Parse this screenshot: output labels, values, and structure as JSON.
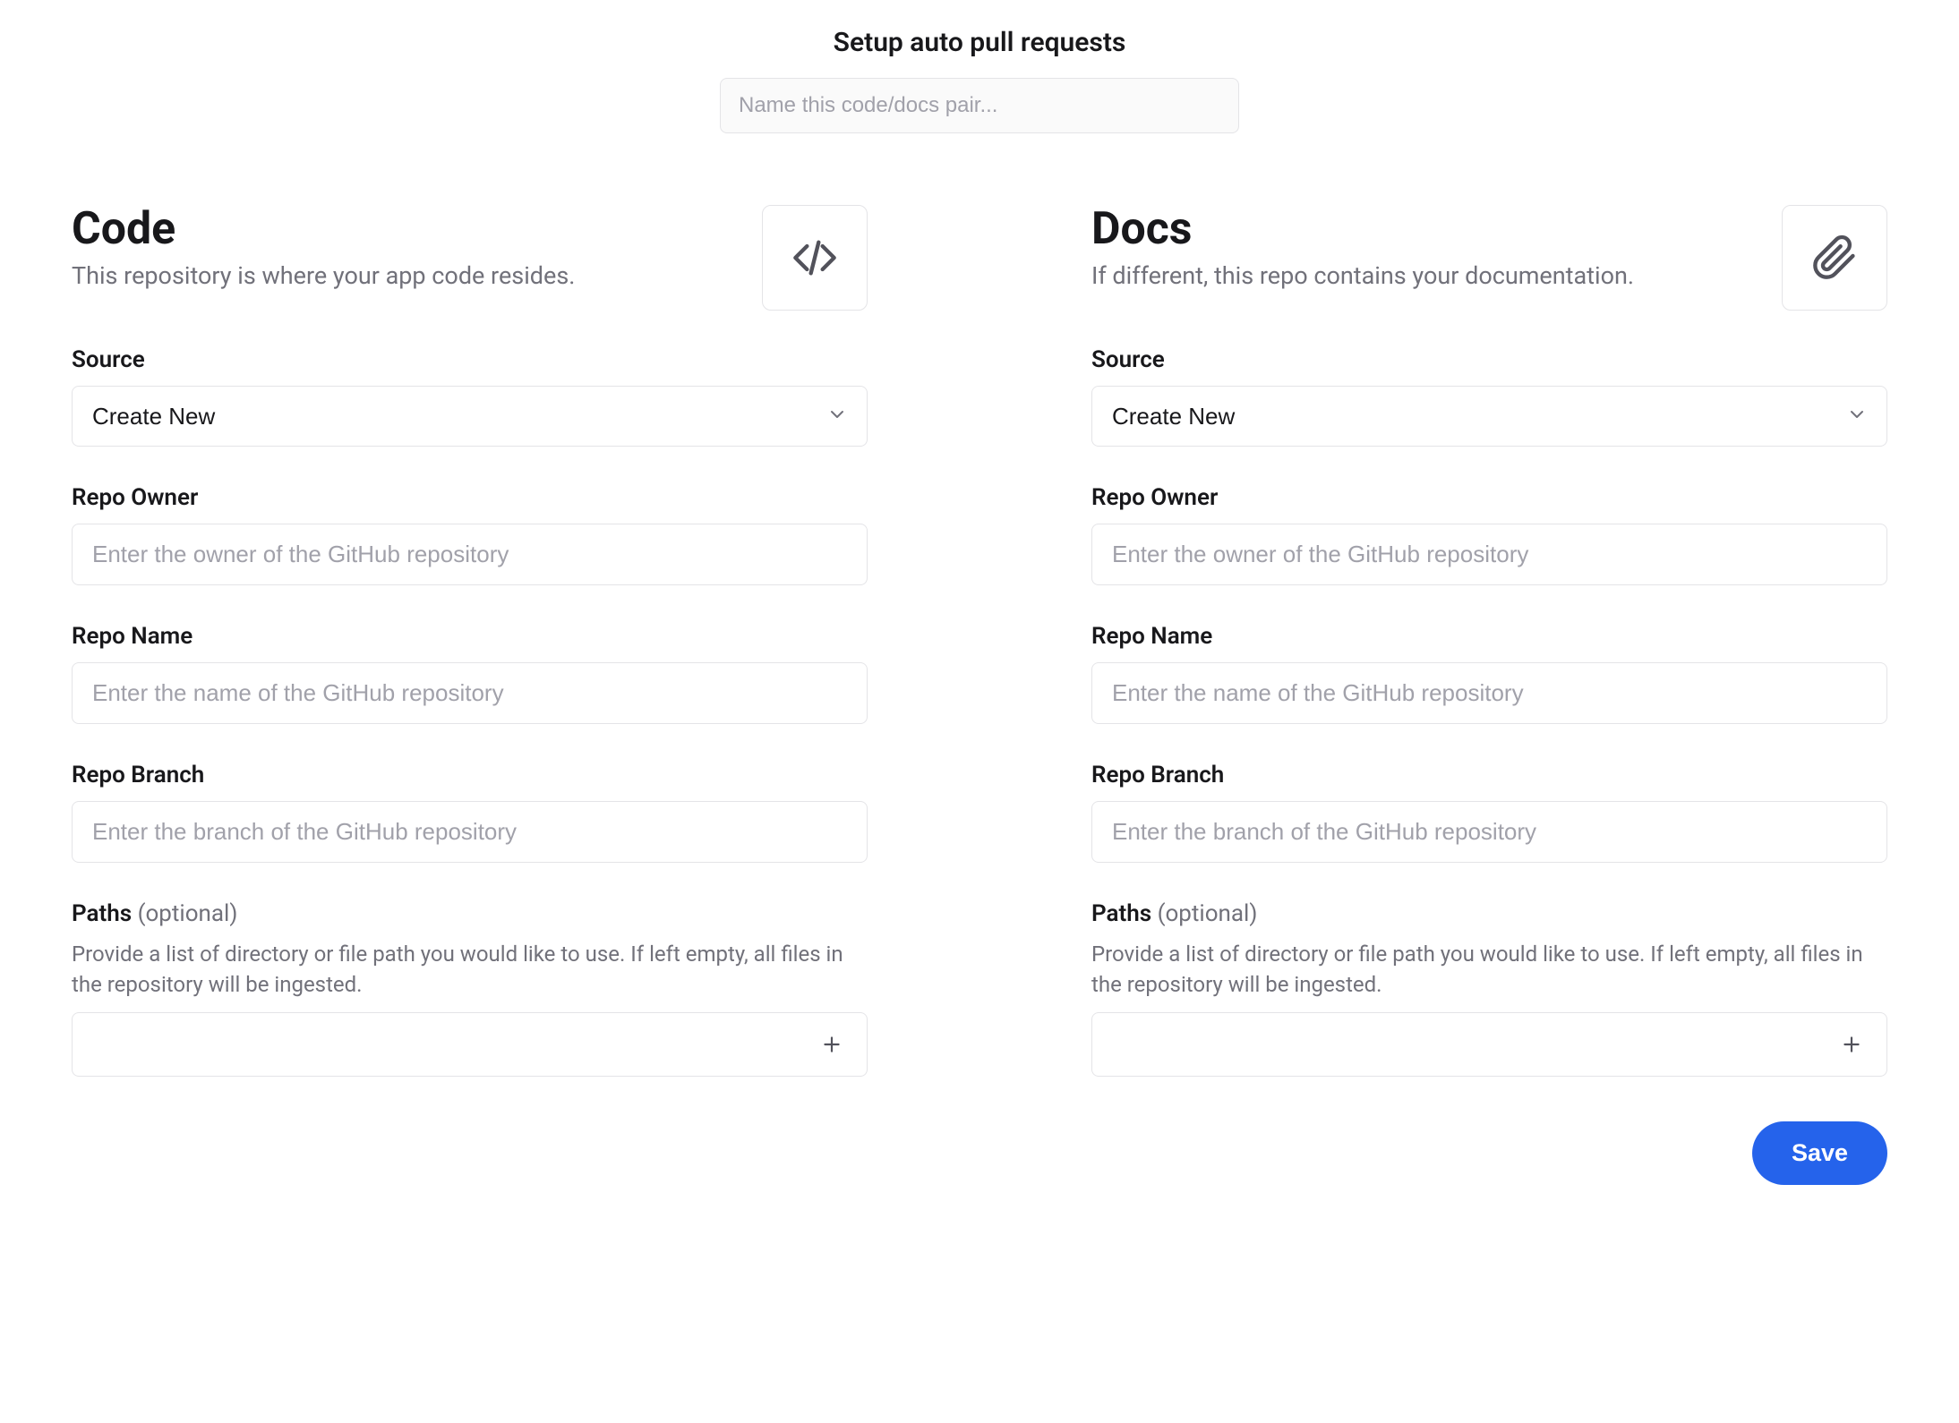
{
  "header": {
    "title": "Setup auto pull requests",
    "name_placeholder": "Name this code/docs pair..."
  },
  "code": {
    "title": "Code",
    "subtitle": "This repository is where your app code resides.",
    "source_label": "Source",
    "source_value": "Create New",
    "owner_label": "Repo Owner",
    "owner_placeholder": "Enter the owner of the GitHub repository",
    "name_label": "Repo Name",
    "name_placeholder": "Enter the name of the GitHub repository",
    "branch_label": "Repo Branch",
    "branch_placeholder": "Enter the branch of the GitHub repository",
    "paths_label": "Paths",
    "paths_optional": " (optional)",
    "paths_help": "Provide a list of directory or file path you would like to use. If left empty, all files in the repository will be ingested."
  },
  "docs": {
    "title": "Docs",
    "subtitle": "If different, this repo contains your documentation.",
    "source_label": "Source",
    "source_value": "Create New",
    "owner_label": "Repo Owner",
    "owner_placeholder": "Enter the owner of the GitHub repository",
    "name_label": "Repo Name",
    "name_placeholder": "Enter the name of the GitHub repository",
    "branch_label": "Repo Branch",
    "branch_placeholder": "Enter the branch of the GitHub repository",
    "paths_label": "Paths",
    "paths_optional": " (optional)",
    "paths_help": "Provide a list of directory or file path you would like to use. If left empty, all files in the repository will be ingested."
  },
  "footer": {
    "save_label": "Save"
  }
}
